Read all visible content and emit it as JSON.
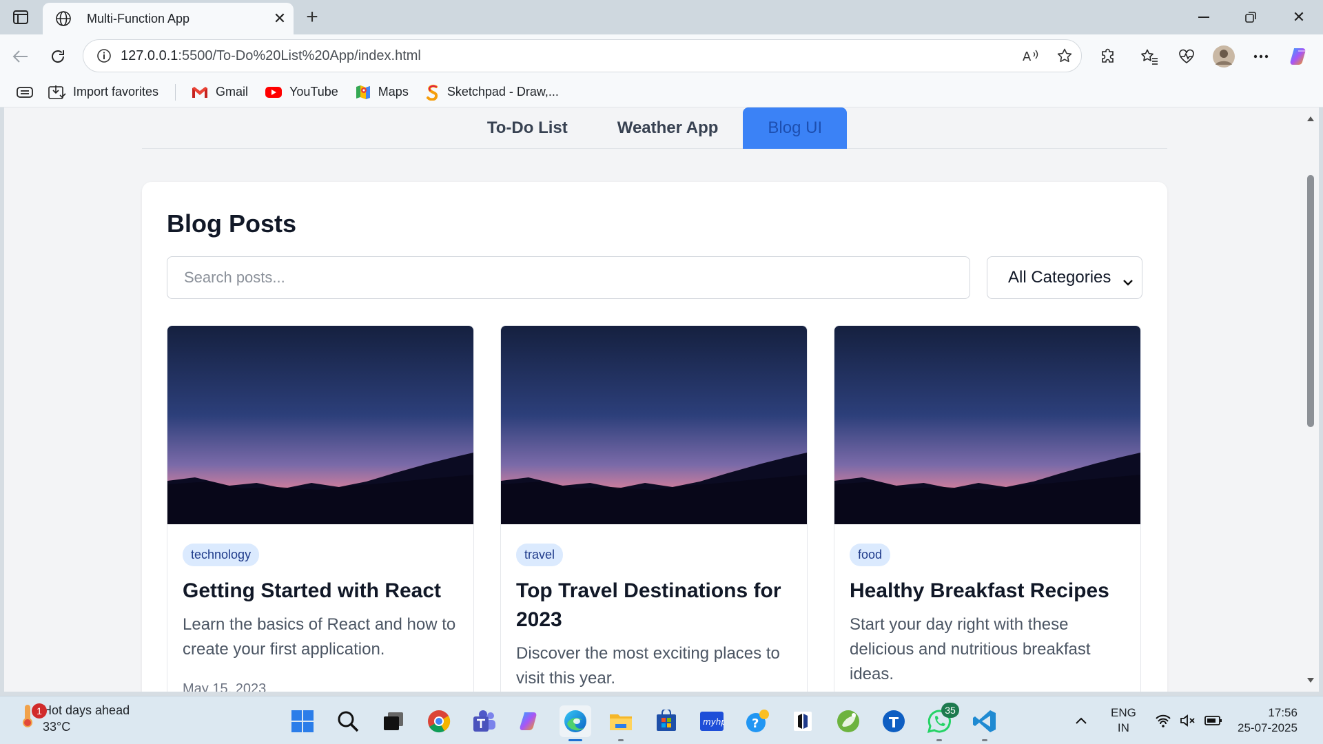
{
  "browser": {
    "tab_title": "Multi-Function App",
    "url_host": "127.0.0.1",
    "url_path": ":5500/To-Do%20List%20App/index.html",
    "favorites": [
      {
        "label": "Import favorites",
        "icon": "import-icon"
      },
      {
        "label": "Gmail",
        "icon": "gmail-icon"
      },
      {
        "label": "YouTube",
        "icon": "youtube-icon"
      },
      {
        "label": "Maps",
        "icon": "maps-icon"
      },
      {
        "label": "Sketchpad - Draw,...",
        "icon": "sketchpad-icon"
      }
    ]
  },
  "app": {
    "tabs": [
      {
        "label": "To-Do List",
        "active": false
      },
      {
        "label": "Weather App",
        "active": false
      },
      {
        "label": "Blog UI",
        "active": true
      }
    ],
    "heading": "Blog Posts",
    "search_placeholder": "Search posts...",
    "category_selected": "All Categories",
    "accent_color": "#3b82f6",
    "posts": [
      {
        "category": "technology",
        "title": "Getting Started with React",
        "excerpt": "Learn the basics of React and how to create your first application.",
        "date": "May 15, 2023"
      },
      {
        "category": "travel",
        "title": "Top Travel Destinations for 2023",
        "excerpt": "Discover the most exciting places to visit this year.",
        "date": ""
      },
      {
        "category": "food",
        "title": "Healthy Breakfast Recipes",
        "excerpt": "Start your day right with these delicious and nutritious breakfast ideas.",
        "date": ""
      }
    ]
  },
  "taskbar": {
    "weather_title": "Hot days ahead",
    "weather_temp": "33°C",
    "weather_badge": "1",
    "whatsapp_badge": "35",
    "lang_line1": "ENG",
    "lang_line2": "IN",
    "time": "17:56",
    "date": "25-07-2025"
  }
}
